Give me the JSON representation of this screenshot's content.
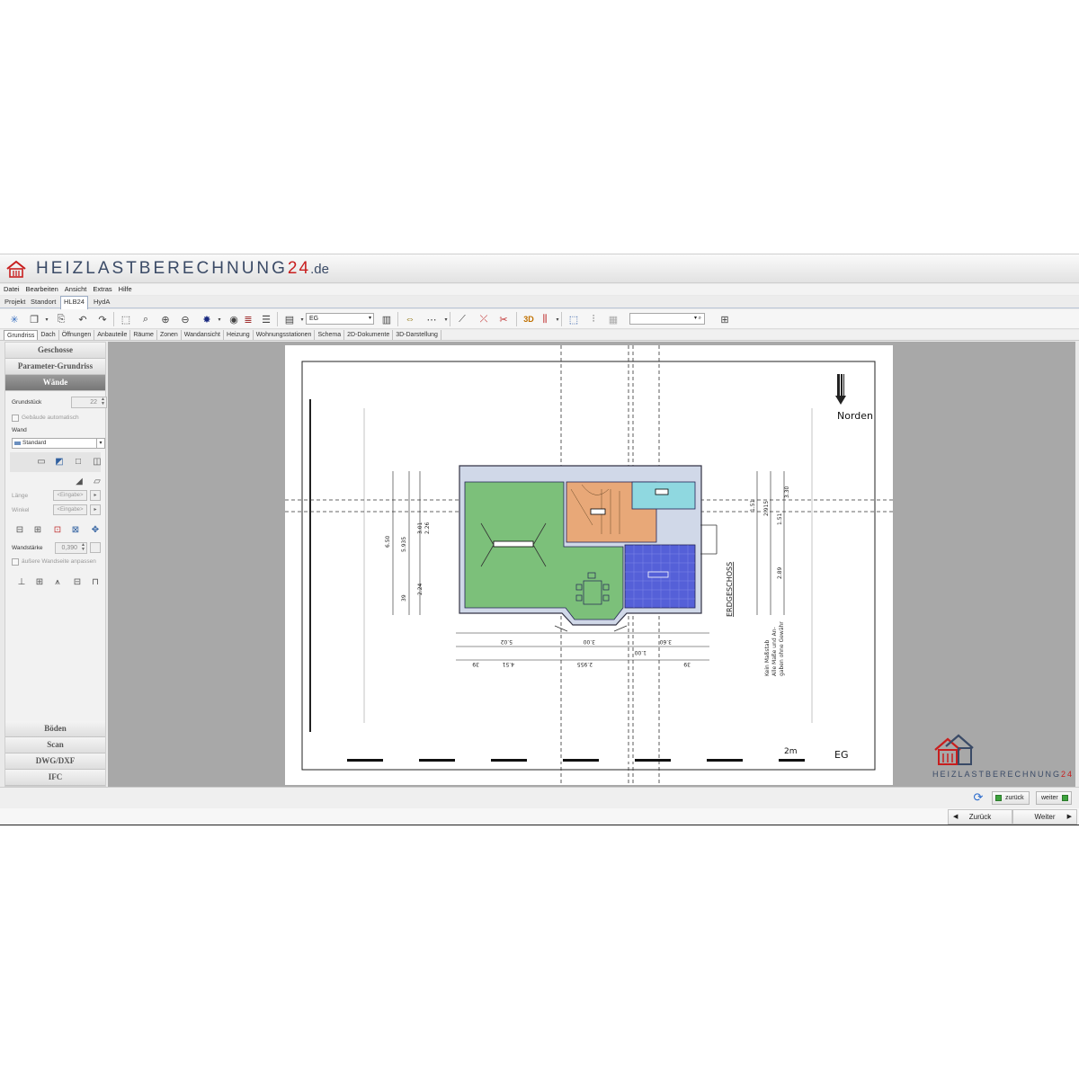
{
  "app": {
    "brand_main": "HEIZLASTBERECHNUNG",
    "brand_num": "24",
    "brand_tld": ".de"
  },
  "menu": [
    "Datei",
    "Bearbeiten",
    "Ansicht",
    "Extras",
    "Hilfe"
  ],
  "top_tabs": [
    "Projekt",
    "Standort",
    "HLB24",
    "HydA"
  ],
  "toolbar": {
    "floor_value": "EG",
    "search_value": "",
    "threeD_label": "3D"
  },
  "view_tabs": [
    "Grundriss",
    "Dach",
    "Öffnungen",
    "Anbauteile",
    "Räume",
    "Zonen",
    "Wandansicht",
    "Heizung",
    "Wohnungsstationen",
    "Schema",
    "2D-Dokumente",
    "3D-Darstellung"
  ],
  "sidebar": {
    "sections_top": [
      "Geschosse",
      "Parameter-Grundriss",
      "Wände"
    ],
    "sections_bottom": [
      "Böden",
      "Scan",
      "DWG/DXF",
      "IFC"
    ],
    "walls": {
      "grundstueck_label": "Grundstück",
      "grundstueck_value": "22",
      "auto_building_label": "Gebäude automatisch",
      "wand_label": "Wand",
      "wand_value": "Standard",
      "laenge_label": "Länge",
      "winkel_label": "Winkel",
      "input_placeholder": "<Eingabe>",
      "wandstaerke_label": "Wandstärke",
      "wandstaerke_value": "0,390",
      "outer_side_label": "äußere Wandseite anpassen"
    }
  },
  "plan": {
    "north_label": "Norden",
    "scale_label": "2m",
    "floor_label": "EG",
    "erdgeschoss_label": "ERDGESCHOSS",
    "note_line1": "Kein Maßstab",
    "note_line2": "Alle Maße und An-",
    "note_line3": "gaben ohne Gewähr",
    "room_colors": {
      "living": "#7cc07a",
      "hall": "#e8a878",
      "bath": "#8fd8e0",
      "kitchen": "#5560d8"
    },
    "dims_bottom_top": [
      "5.02",
      "3.00",
      "3.60"
    ],
    "dims_bottom_bottom": [
      "39",
      "4.51",
      "2.955",
      "1.00",
      "39"
    ],
    "dims_left": [
      "6.50",
      "5.935",
      "3.01",
      "2.26",
      "2.24",
      "39"
    ],
    "dims_right": [
      "1.51",
      "2.915",
      "3.30",
      "1.51",
      "2.89"
    ]
  },
  "watermark": {
    "main": "HEIZLASTBERECHNUNG",
    "num": "24"
  },
  "status": {
    "back_small": "zurück",
    "next_small": "weiter"
  },
  "nav": {
    "back": "Zurück",
    "next": "Weiter"
  },
  "colors": {
    "brand_blue": "#3a4a66",
    "brand_red": "#c81e1e",
    "accent_green": "#3da33d"
  }
}
